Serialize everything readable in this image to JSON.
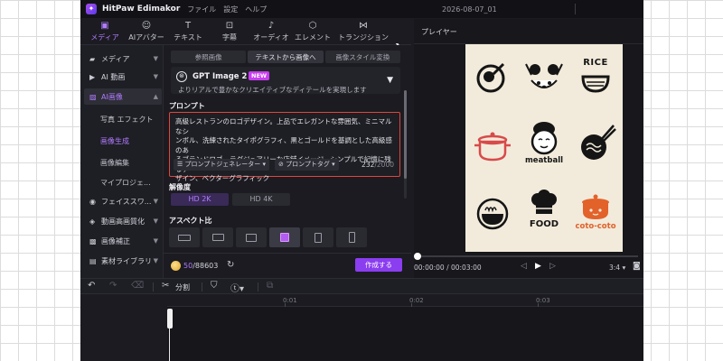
{
  "titlebar": {
    "app_name": "HitPaw Edimakor",
    "menu": [
      "ファイル",
      "設定",
      "ヘルプ"
    ],
    "window_title": "2026-08-07_01"
  },
  "toolbar": {
    "tools": [
      {
        "label": "メディア",
        "icon": "media-folder-icon",
        "active": true
      },
      {
        "label": "AIアバター",
        "icon": "ai-avatar-icon",
        "active": false
      },
      {
        "label": "テキスト",
        "icon": "text-icon",
        "active": false
      },
      {
        "label": "字幕",
        "icon": "subtitle-icon",
        "active": false
      },
      {
        "label": "オーディオ",
        "icon": "audio-note-icon",
        "active": false
      },
      {
        "label": "エレメント",
        "icon": "element-icon",
        "active": false
      },
      {
        "label": "トランジション",
        "icon": "transition-icon",
        "active": false
      }
    ]
  },
  "sidebar": {
    "items": [
      {
        "label": "メディア",
        "icon": "folder-icon"
      },
      {
        "label": "AI 動画",
        "icon": "ai-video-icon"
      },
      {
        "label": "AI画像",
        "icon": "ai-image-icon",
        "active": true
      }
    ],
    "subitems": [
      {
        "label": "写真 エフェクト"
      },
      {
        "label": "画像生成",
        "active": true
      },
      {
        "label": "画像編集"
      },
      {
        "label": "マイプロジェ..."
      }
    ],
    "items_bottom": [
      {
        "label": "フェイススワ...",
        "icon": "face-swap-icon"
      },
      {
        "label": "動画高画質化",
        "icon": "enhance-icon"
      },
      {
        "label": "画像補正",
        "icon": "image-fix-icon"
      },
      {
        "label": "素材ライブラリ",
        "icon": "library-icon"
      }
    ]
  },
  "panel": {
    "tabs": [
      "参照画像",
      "テキストから画像へ",
      "画像スタイル変換"
    ],
    "active_tab": 1,
    "model": {
      "name": "GPT Image 2",
      "badge": "NEW",
      "description": "よりリアルで豊かなクリエイティブなディテールを実現します"
    },
    "prompt_label": "プロンプト",
    "prompt_text": "高級レストランのロゴデザイン。上品でエレガントな雰囲気、ミニマルなシ\nンボル、洗練されたタイポグラフィ、黒とゴールドを基調とした高級感のあ\nるブランドロゴ、ラグジュアリーな店舗イメージ、シンプルで記憶に残るデ\nザイン、ベクターグラフィック",
    "prompt_generator": "プロンプトジェネレーター",
    "prompt_tag": "プロンプトタグ",
    "char_count": "232",
    "char_max": "/2000",
    "resolution_label": "解像度",
    "resolutions": [
      "HD 2K",
      "HD 4K"
    ],
    "active_resolution": 0,
    "aspect_label": "アスペクト比",
    "aspect_options": [
      "16:9",
      "3:2",
      "4:3",
      "1:1",
      "3:4",
      "2:3"
    ],
    "active_aspect": 3,
    "credits_current": "50",
    "credits_total": "/88603",
    "create_label": "作成する"
  },
  "player": {
    "title": "プレイヤー",
    "logos": [
      {
        "name": "bowl-spoon-logo",
        "text": ""
      },
      {
        "name": "panda-chopsticks-logo",
        "text": ""
      },
      {
        "name": "rice-bowl-logo",
        "text": "RICE"
      },
      {
        "name": "pot-logo",
        "text": ""
      },
      {
        "name": "meatball-logo",
        "text": "meatball"
      },
      {
        "name": "noodle-chopsticks-logo",
        "text": ""
      },
      {
        "name": "ramen-bowl-logo",
        "text": ""
      },
      {
        "name": "chef-food-logo",
        "text": "FOOD"
      },
      {
        "name": "coto-pot-logo",
        "text": "coto-coto"
      }
    ],
    "time_current": "00:00:00",
    "time_total": "/ 00:03:00",
    "ratio": "3:4"
  },
  "timeline": {
    "split_label": "分割",
    "ticks": [
      "0:01",
      "0:02",
      "0:03"
    ]
  },
  "colors": {
    "accent": "#b07cff",
    "create_button": "#8b3df0",
    "prompt_border": "#e0453a",
    "new_badge": "#c93df0"
  }
}
